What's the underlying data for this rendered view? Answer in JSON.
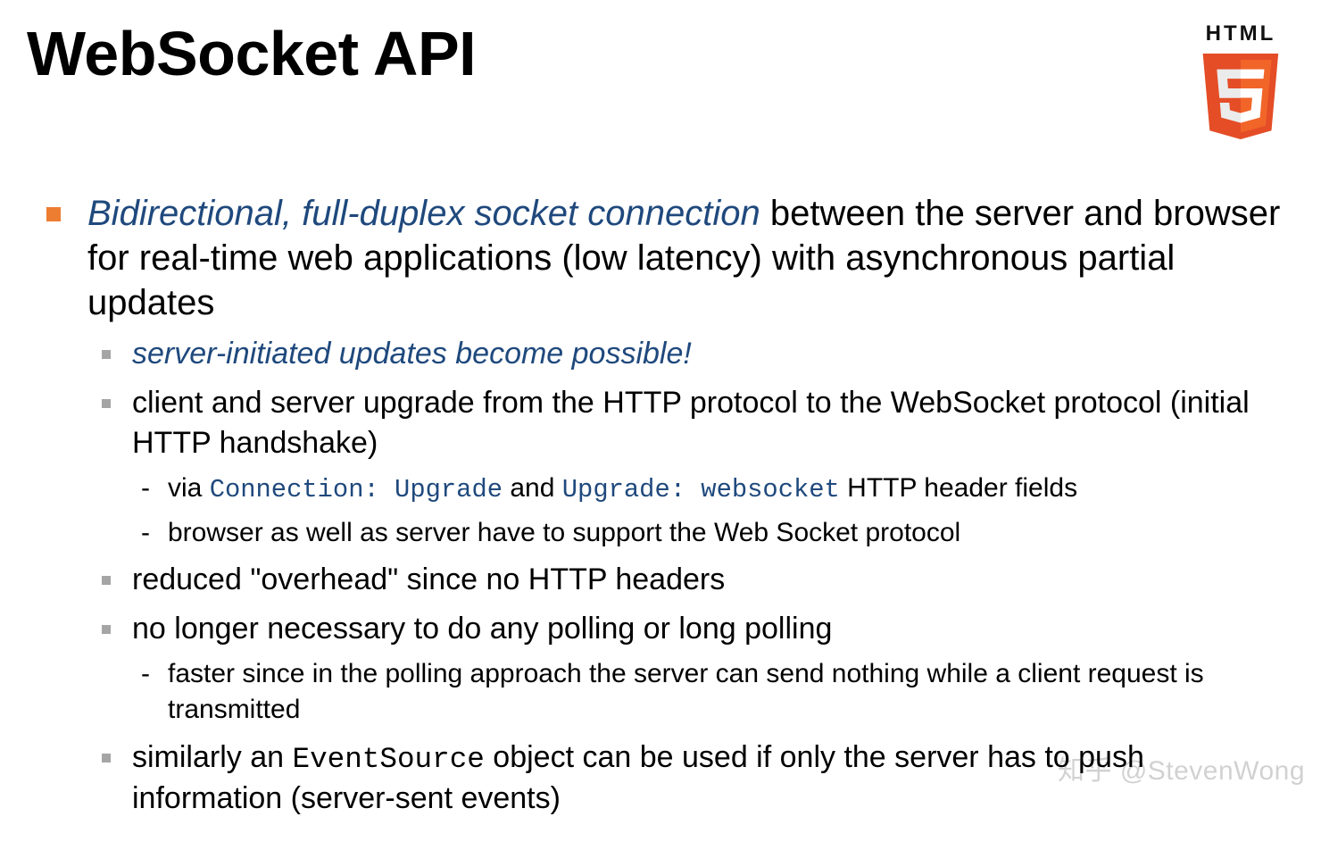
{
  "title": "WebSocket API",
  "logo": {
    "label": "HTML",
    "icon": "html5-shield-icon"
  },
  "bullets": {
    "main": {
      "emph": "Bidirectional, full-duplex socket connection",
      "rest": " between the server and browser for real-time web applications (low latency) with asynchronous partial updates"
    },
    "sub": [
      {
        "emph": "server-initiated updates become possible!",
        "rest": ""
      },
      {
        "text": "client and server upgrade from the HTTP protocol to the WebSocket protocol (initial HTTP handshake)",
        "sub": [
          {
            "prefix": "via ",
            "code1": "Connection: Upgrade",
            "mid": " and ",
            "code2": "Upgrade: websocket",
            "suffix": " HTTP header fields"
          },
          {
            "text": "browser as well as server have to support the Web Socket protocol"
          }
        ]
      },
      {
        "text": "reduced \"overhead\" since no HTTP headers"
      },
      {
        "text": "no longer necessary to do any polling or long polling",
        "sub": [
          {
            "text": "faster since in the polling approach the server can send nothing while a client request is transmitted"
          }
        ]
      },
      {
        "prefix": "similarly an ",
        "code": "EventSource",
        "suffix": " object can be used if only the server has to push information (server-sent events)"
      }
    ]
  },
  "watermark": "知乎 @StevenWong"
}
